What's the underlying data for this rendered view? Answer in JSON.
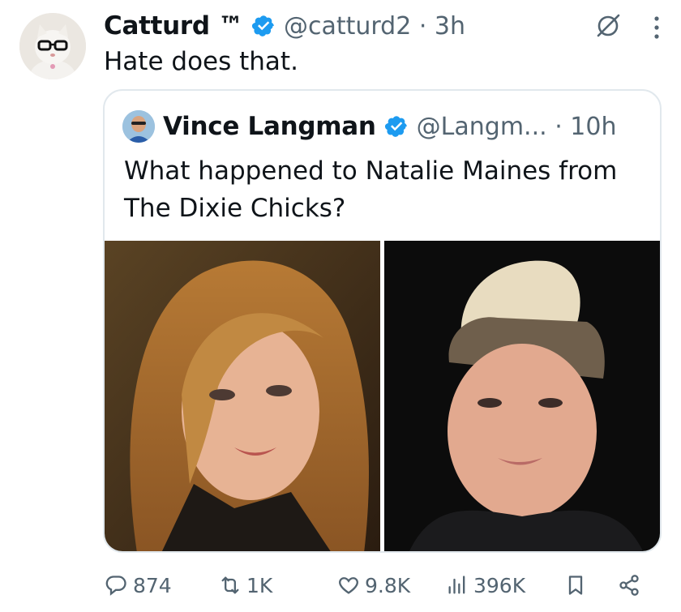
{
  "tweet": {
    "display_name": "Catturd ™",
    "handle_time": "@catturd2 · 3h",
    "text": "Hate does that.",
    "avatar_icon": "cat-with-glasses-avatar",
    "verified_color": "#1d9bf0"
  },
  "quoted_tweet": {
    "display_name": "Vince Langman",
    "handle_time": "@Langm... · 10h",
    "text": "What happened to Natalie Maines from The Dixie Chicks?",
    "images": [
      "photo-blonde-long-hair",
      "photo-platinum-mohawk"
    ]
  },
  "actions": {
    "replies": "874",
    "reposts": "1K",
    "likes": "9.8K",
    "views": "396K"
  },
  "icons": {
    "grok": "grok-icon",
    "more": "more-icon",
    "reply": "reply-icon",
    "repost": "repost-icon",
    "like": "heart-icon",
    "views": "views-icon",
    "bookmark": "bookmark-icon",
    "share": "share-icon"
  }
}
